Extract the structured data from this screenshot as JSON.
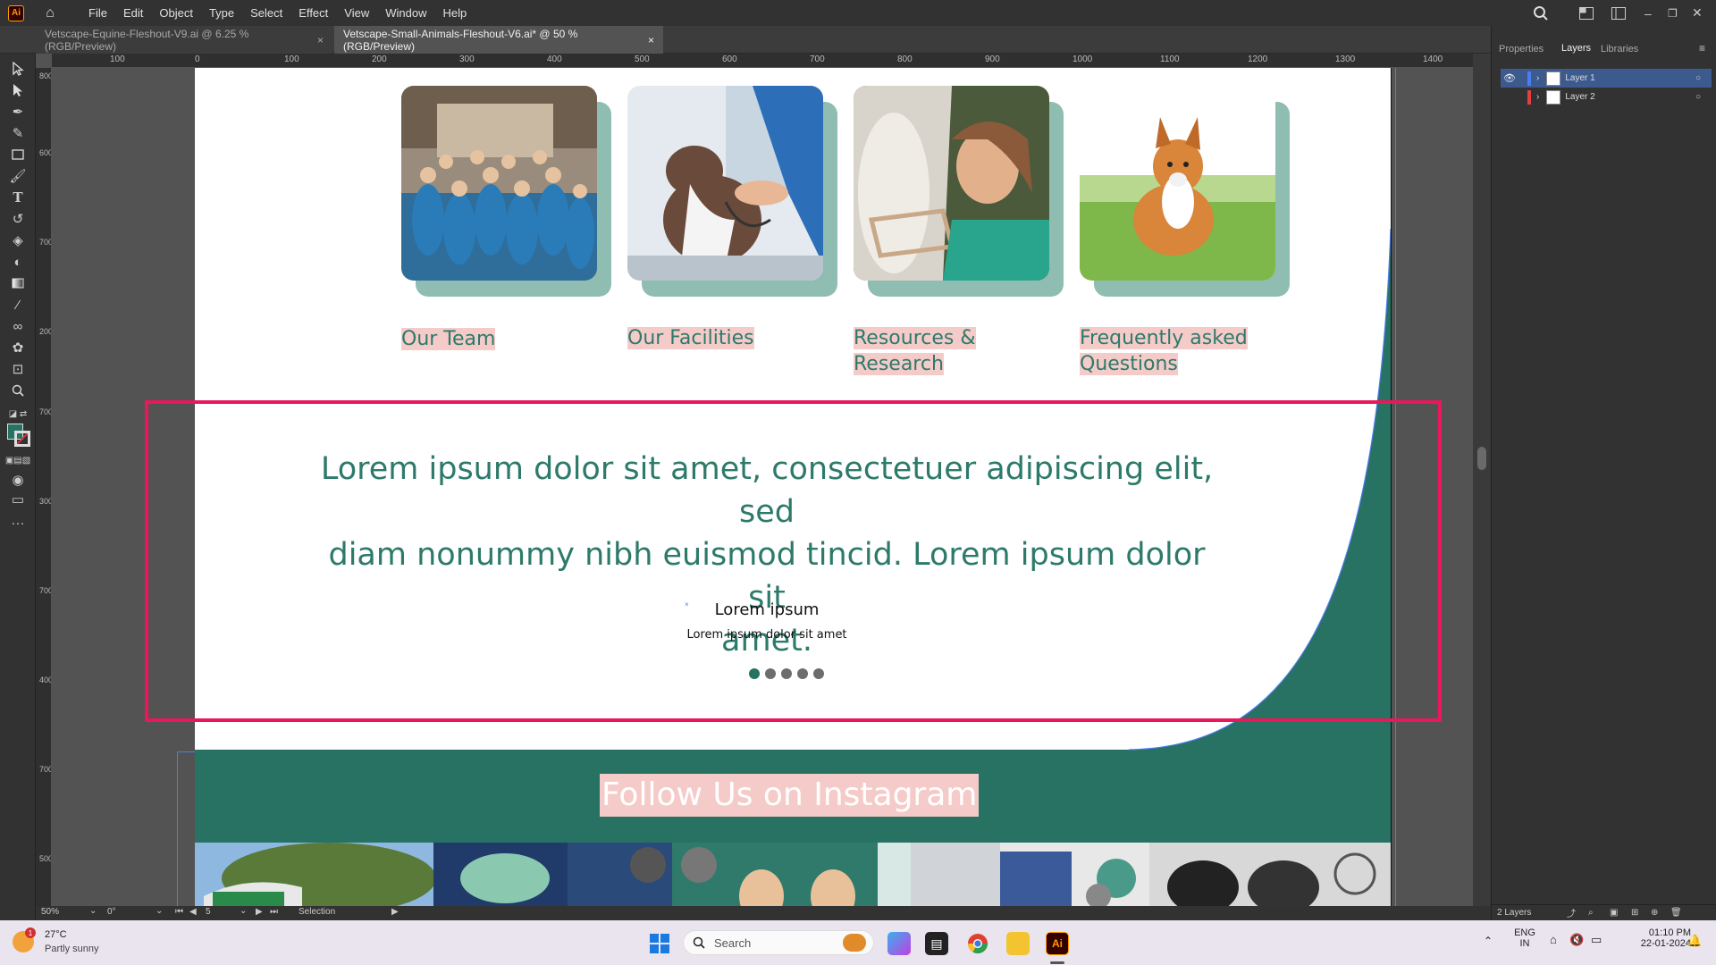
{
  "app": {
    "logo": "Ai",
    "accent": "#ff9a00"
  },
  "menu": [
    "File",
    "Edit",
    "Object",
    "Type",
    "Select",
    "Effect",
    "View",
    "Window",
    "Help"
  ],
  "tabs": [
    {
      "label": "Vetscape-Equine-Fleshout-V9.ai @ 6.25 % (RGB/Preview)",
      "active": false
    },
    {
      "label": "Vetscape-Small-Animals-Fleshout-V6.ai* @ 50 % (RGB/Preview)",
      "active": true
    }
  ],
  "tab_close": "×",
  "panel": {
    "tabs": [
      "Properties",
      "Layers",
      "Libraries"
    ],
    "layers": [
      {
        "name": "Layer 1",
        "color": "#4a7df0"
      },
      {
        "name": "Layer 2",
        "color": "#e04040"
      }
    ],
    "footer": "2 Layers"
  },
  "ruler": {
    "h_labels": [
      "100",
      "0",
      "100",
      "200",
      "300",
      "400",
      "500",
      "600",
      "700",
      "800",
      "900",
      "1000",
      "1100",
      "1200",
      "1300",
      "1400"
    ],
    "v_labels": [
      "800",
      "600",
      "700",
      "200",
      "700",
      "300",
      "700",
      "400",
      "700",
      "500",
      "700",
      "600",
      "700",
      "700",
      "700",
      "800"
    ]
  },
  "artboard": {
    "cards": [
      {
        "label_lines": [
          "Our Team"
        ]
      },
      {
        "label_lines": [
          "Our Facilities"
        ]
      },
      {
        "label_lines": [
          "Resources &",
          "Research"
        ]
      },
      {
        "label_lines": [
          "Frequently asked",
          "Questions"
        ]
      }
    ],
    "quote_lines": [
      "Lorem ipsum dolor sit amet, consectetuer adipiscing elit, sed",
      "diam nonummy nibh euismod tincid. Lorem ipsum dolor sit",
      "amet."
    ],
    "author": "Lorem ipsum",
    "author_sub": "Lorem ipsum dolor sit amet",
    "slider": {
      "count": 5,
      "active_index": 0
    },
    "instagram_title": "Follow Us on Instagram",
    "colors": {
      "teal": "#277262",
      "text_teal": "#2d7a6a",
      "label_highlight": "#f5cbc9",
      "selection_box": "#e8185a"
    }
  },
  "status": {
    "zoom": "50%",
    "rotation": "0°",
    "artboard": "5",
    "tool": "Selection"
  },
  "taskbar": {
    "weather_temp": "27°C",
    "weather_desc": "Partly sunny",
    "weather_badge": "1",
    "search_placeholder": "Search",
    "lang": "ENG",
    "region": "IN",
    "time": "01:10 PM",
    "date": "22-01-2024"
  }
}
